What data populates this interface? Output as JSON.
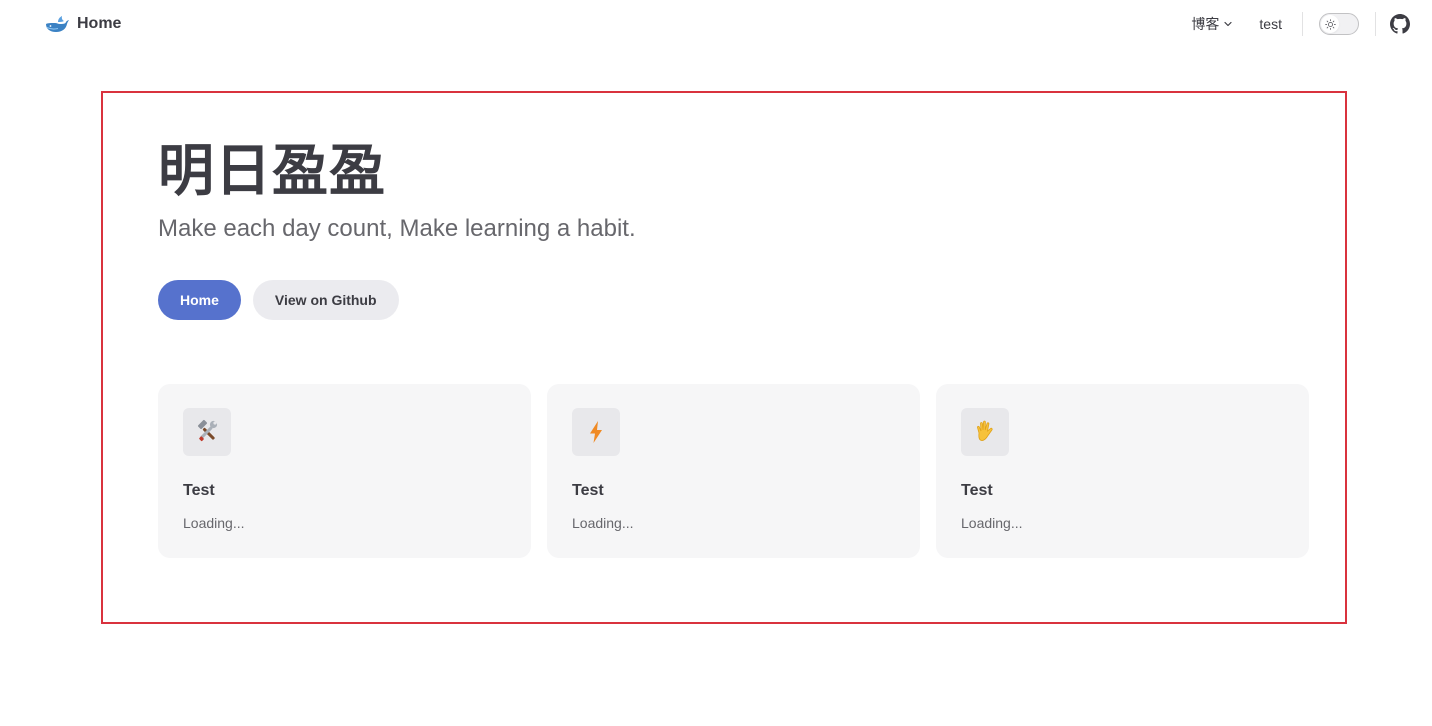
{
  "nav": {
    "brand_title": "Home",
    "menu": [
      {
        "label": "博客",
        "has_dropdown": true
      },
      {
        "label": "test",
        "has_dropdown": false
      }
    ],
    "appearance_icon": "sun-icon",
    "github_icon": "github-icon"
  },
  "hero": {
    "name": "明日盈盈",
    "tagline": "Make each day count, Make learning a habit.",
    "actions": [
      {
        "label": "Home",
        "theme": "brand"
      },
      {
        "label": "View on Github",
        "theme": "alt"
      }
    ]
  },
  "features": [
    {
      "icon": "hammer-wrench-icon",
      "title": "Test",
      "details": "Loading..."
    },
    {
      "icon": "lightning-icon",
      "title": "Test",
      "details": "Loading..."
    },
    {
      "icon": "raised-hand-icon",
      "title": "Test",
      "details": "Loading..."
    }
  ],
  "colors": {
    "brand": "#5672cd",
    "frame_border": "#d9323e",
    "card_bg": "#f6f6f7",
    "text": "#3c3c43"
  }
}
